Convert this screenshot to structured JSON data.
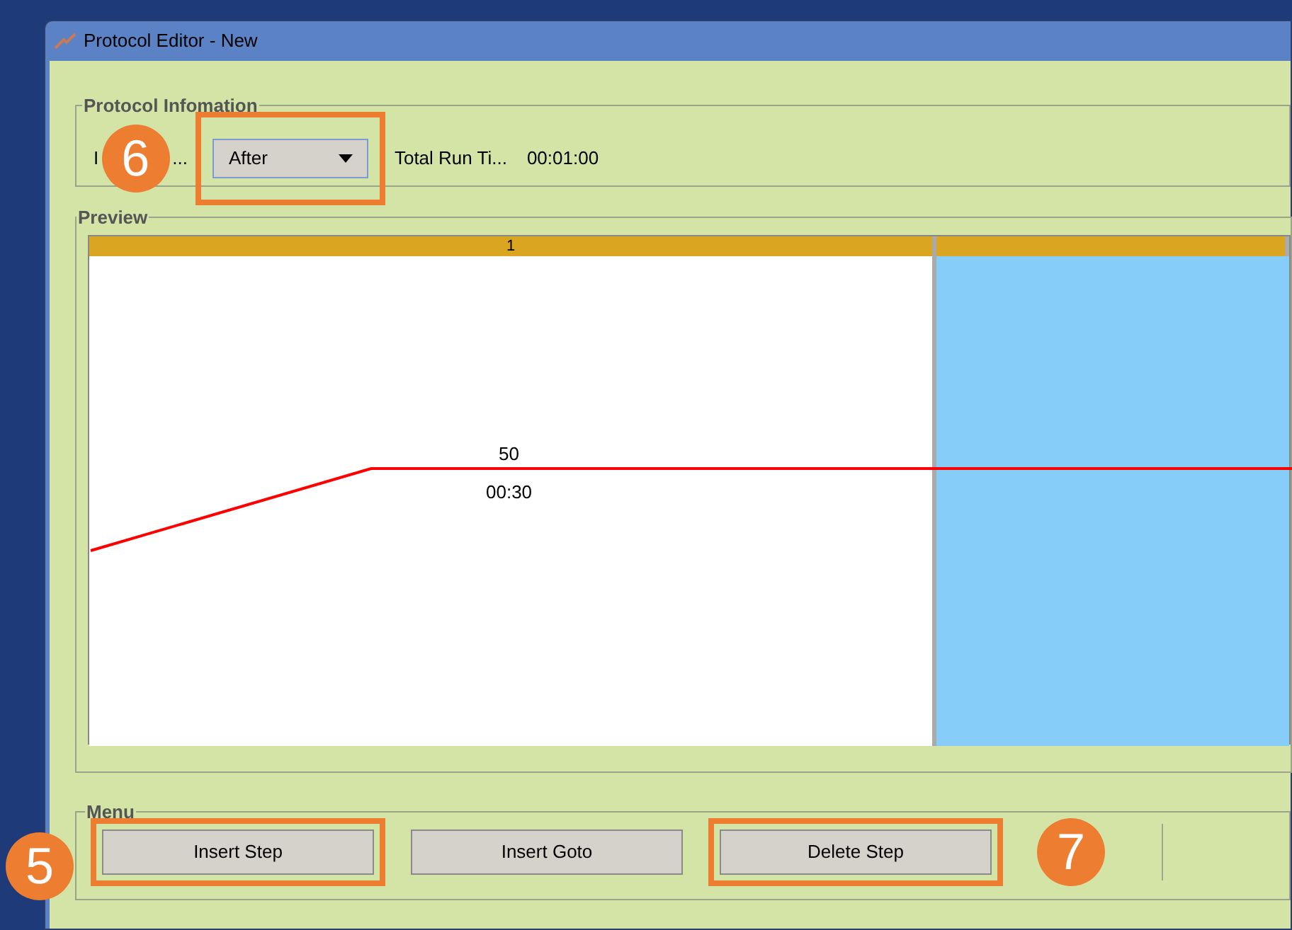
{
  "window": {
    "title": "Protocol Editor - New"
  },
  "protocol_info": {
    "legend": "Protocol Infomation",
    "label_start": "I",
    "label_end": "...",
    "dropdown": {
      "value": "After",
      "callout": "6"
    },
    "total_label": "Total Run Ti...",
    "total_value": "00:01:00"
  },
  "preview": {
    "legend": "Preview",
    "steps": [
      {
        "header": "1",
        "selected": false,
        "value_label": "50",
        "time_label": "00:30"
      },
      {
        "selected": true
      }
    ]
  },
  "menu": {
    "legend": "Menu",
    "buttons": [
      {
        "label": "Insert Step",
        "callout": "5"
      },
      {
        "label": "Insert Goto"
      },
      {
        "label": "Delete Step",
        "callout": "7"
      }
    ]
  }
}
